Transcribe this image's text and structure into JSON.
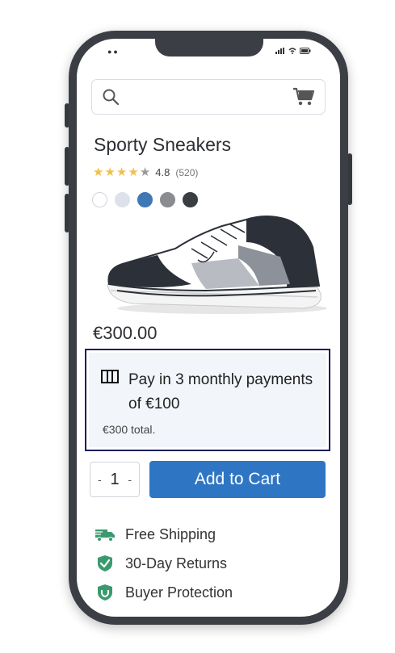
{
  "product": {
    "title": "Sporty Sneakers",
    "rating_value": "4.8",
    "review_count": "(520)",
    "stars_filled": 4,
    "stars_total": 5,
    "price": "€300.00"
  },
  "colors": {
    "star_filled": "#f2c04a",
    "star_empty": "#9a9a9a",
    "swatches": [
      "#ffffff",
      "#dde2ea",
      "#3f78b5",
      "#8a8c90",
      "#3a3d42"
    ],
    "accent": "#2e76c4",
    "feature_green": "#3a9a6e",
    "highlight_border": "#1d1d5e"
  },
  "installment": {
    "text": "Pay in 3 monthly payments of €100",
    "total": "€300 total."
  },
  "quantity": {
    "minus": "-",
    "value": "1",
    "plus": "-"
  },
  "cart": {
    "add_label": "Add to Cart"
  },
  "features": [
    {
      "label": "Free Shipping",
      "icon": "truck-icon"
    },
    {
      "label": "30-Day Returns",
      "icon": "shield-check-icon"
    },
    {
      "label": "Buyer Protection",
      "icon": "shield-icon"
    }
  ]
}
